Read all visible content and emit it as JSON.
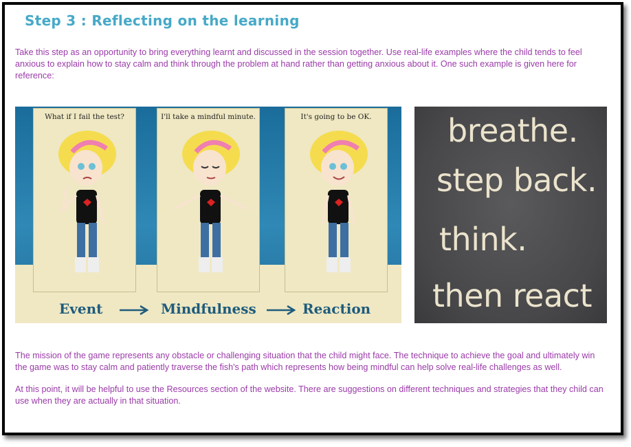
{
  "page": {
    "title": "Step 3 : Reflecting on the learning",
    "intro": "Take this step as an opportunity to bring everything learnt and discussed in the session together. Use real-life examples where the child tends to feel anxious to explain how to stay calm and think through the problem at hand rather than getting anxious about it. One such example is given here for reference:",
    "paragraph2": "The mission of the game represents any obstacle or challenging situation that the child might face. The technique to achieve the goal and ultimately win the game was to stay calm and patiently traverse the fish's path which represents how being mindful can help solve real-life challenges as well.",
    "paragraph3": "At this point, it will be helpful to use the Resources section of the website. There are suggestions on different techniques and strategies that they child can use when they are actually in that situation."
  },
  "comic": {
    "panels": [
      {
        "caption": "What if I fail the test?"
      },
      {
        "caption": "I'll take a mindful minute."
      },
      {
        "caption": "It's going to be OK."
      }
    ],
    "labels": [
      "Event",
      "Mindfulness",
      "Reaction"
    ]
  },
  "chalkboard": {
    "lines": [
      "breathe.",
      "step back.",
      "think.",
      "then react"
    ]
  },
  "colors": {
    "title": "#46a9c8",
    "body_text": "#9a3aa8",
    "comic_label": "#1f5b7c"
  }
}
